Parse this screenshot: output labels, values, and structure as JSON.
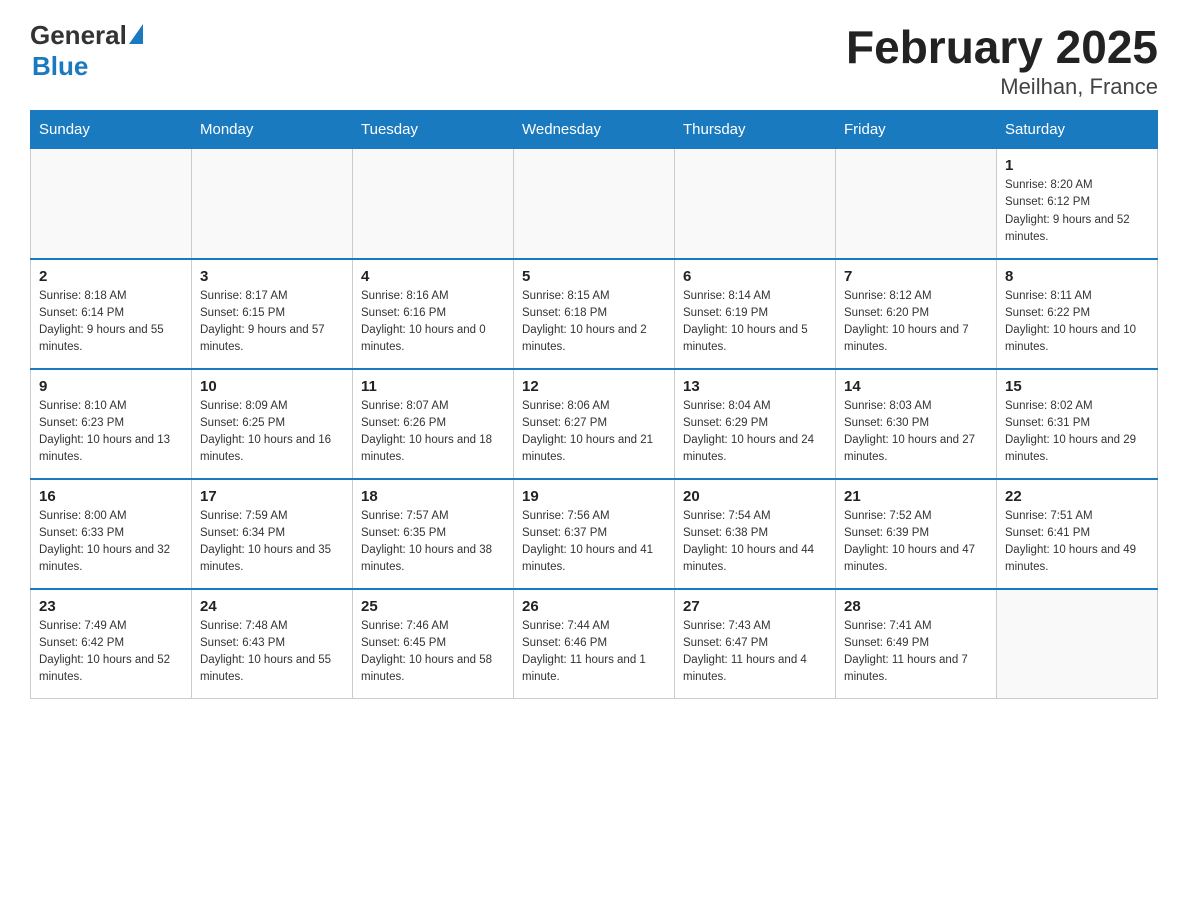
{
  "logo": {
    "text_general": "General",
    "text_blue": "Blue"
  },
  "title": "February 2025",
  "subtitle": "Meilhan, France",
  "days_of_week": [
    "Sunday",
    "Monday",
    "Tuesday",
    "Wednesday",
    "Thursday",
    "Friday",
    "Saturday"
  ],
  "weeks": [
    [
      {
        "day": "",
        "info": ""
      },
      {
        "day": "",
        "info": ""
      },
      {
        "day": "",
        "info": ""
      },
      {
        "day": "",
        "info": ""
      },
      {
        "day": "",
        "info": ""
      },
      {
        "day": "",
        "info": ""
      },
      {
        "day": "1",
        "info": "Sunrise: 8:20 AM\nSunset: 6:12 PM\nDaylight: 9 hours and 52 minutes."
      }
    ],
    [
      {
        "day": "2",
        "info": "Sunrise: 8:18 AM\nSunset: 6:14 PM\nDaylight: 9 hours and 55 minutes."
      },
      {
        "day": "3",
        "info": "Sunrise: 8:17 AM\nSunset: 6:15 PM\nDaylight: 9 hours and 57 minutes."
      },
      {
        "day": "4",
        "info": "Sunrise: 8:16 AM\nSunset: 6:16 PM\nDaylight: 10 hours and 0 minutes."
      },
      {
        "day": "5",
        "info": "Sunrise: 8:15 AM\nSunset: 6:18 PM\nDaylight: 10 hours and 2 minutes."
      },
      {
        "day": "6",
        "info": "Sunrise: 8:14 AM\nSunset: 6:19 PM\nDaylight: 10 hours and 5 minutes."
      },
      {
        "day": "7",
        "info": "Sunrise: 8:12 AM\nSunset: 6:20 PM\nDaylight: 10 hours and 7 minutes."
      },
      {
        "day": "8",
        "info": "Sunrise: 8:11 AM\nSunset: 6:22 PM\nDaylight: 10 hours and 10 minutes."
      }
    ],
    [
      {
        "day": "9",
        "info": "Sunrise: 8:10 AM\nSunset: 6:23 PM\nDaylight: 10 hours and 13 minutes."
      },
      {
        "day": "10",
        "info": "Sunrise: 8:09 AM\nSunset: 6:25 PM\nDaylight: 10 hours and 16 minutes."
      },
      {
        "day": "11",
        "info": "Sunrise: 8:07 AM\nSunset: 6:26 PM\nDaylight: 10 hours and 18 minutes."
      },
      {
        "day": "12",
        "info": "Sunrise: 8:06 AM\nSunset: 6:27 PM\nDaylight: 10 hours and 21 minutes."
      },
      {
        "day": "13",
        "info": "Sunrise: 8:04 AM\nSunset: 6:29 PM\nDaylight: 10 hours and 24 minutes."
      },
      {
        "day": "14",
        "info": "Sunrise: 8:03 AM\nSunset: 6:30 PM\nDaylight: 10 hours and 27 minutes."
      },
      {
        "day": "15",
        "info": "Sunrise: 8:02 AM\nSunset: 6:31 PM\nDaylight: 10 hours and 29 minutes."
      }
    ],
    [
      {
        "day": "16",
        "info": "Sunrise: 8:00 AM\nSunset: 6:33 PM\nDaylight: 10 hours and 32 minutes."
      },
      {
        "day": "17",
        "info": "Sunrise: 7:59 AM\nSunset: 6:34 PM\nDaylight: 10 hours and 35 minutes."
      },
      {
        "day": "18",
        "info": "Sunrise: 7:57 AM\nSunset: 6:35 PM\nDaylight: 10 hours and 38 minutes."
      },
      {
        "day": "19",
        "info": "Sunrise: 7:56 AM\nSunset: 6:37 PM\nDaylight: 10 hours and 41 minutes."
      },
      {
        "day": "20",
        "info": "Sunrise: 7:54 AM\nSunset: 6:38 PM\nDaylight: 10 hours and 44 minutes."
      },
      {
        "day": "21",
        "info": "Sunrise: 7:52 AM\nSunset: 6:39 PM\nDaylight: 10 hours and 47 minutes."
      },
      {
        "day": "22",
        "info": "Sunrise: 7:51 AM\nSunset: 6:41 PM\nDaylight: 10 hours and 49 minutes."
      }
    ],
    [
      {
        "day": "23",
        "info": "Sunrise: 7:49 AM\nSunset: 6:42 PM\nDaylight: 10 hours and 52 minutes."
      },
      {
        "day": "24",
        "info": "Sunrise: 7:48 AM\nSunset: 6:43 PM\nDaylight: 10 hours and 55 minutes."
      },
      {
        "day": "25",
        "info": "Sunrise: 7:46 AM\nSunset: 6:45 PM\nDaylight: 10 hours and 58 minutes."
      },
      {
        "day": "26",
        "info": "Sunrise: 7:44 AM\nSunset: 6:46 PM\nDaylight: 11 hours and 1 minute."
      },
      {
        "day": "27",
        "info": "Sunrise: 7:43 AM\nSunset: 6:47 PM\nDaylight: 11 hours and 4 minutes."
      },
      {
        "day": "28",
        "info": "Sunrise: 7:41 AM\nSunset: 6:49 PM\nDaylight: 11 hours and 7 minutes."
      },
      {
        "day": "",
        "info": ""
      }
    ]
  ]
}
